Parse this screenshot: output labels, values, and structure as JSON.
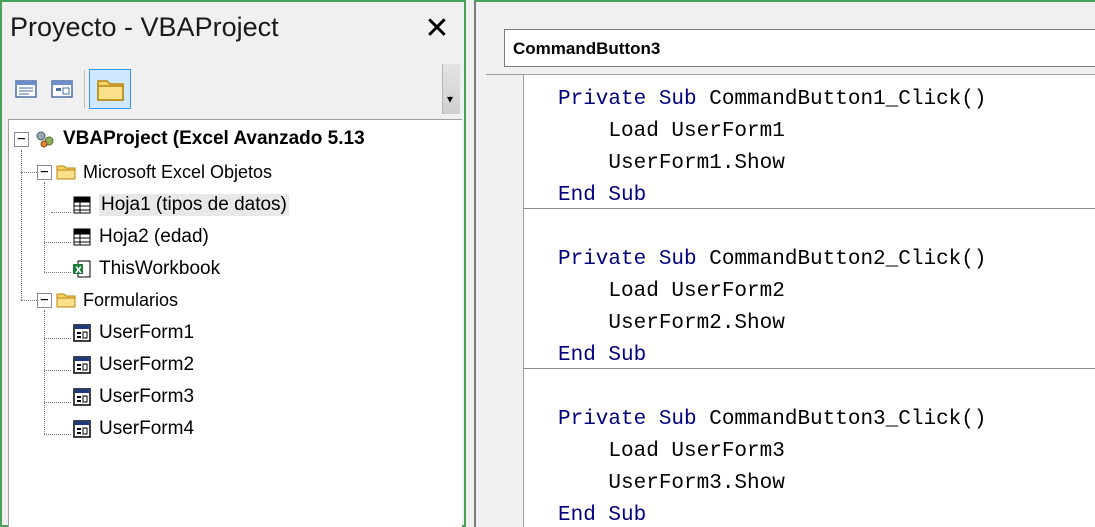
{
  "project_pane": {
    "title": "Proyecto - VBAProject",
    "close_label": "✕",
    "tree": {
      "root": "VBAProject (Excel Avanzado 5.13",
      "folders": [
        {
          "label": "Microsoft Excel Objetos",
          "items": [
            "Hoja1 (tipos de datos)",
            "Hoja2 (edad)",
            "ThisWorkbook"
          ]
        },
        {
          "label": "Formularios",
          "items": [
            "UserForm1",
            "UserForm2",
            "UserForm3",
            "UserForm4"
          ]
        }
      ],
      "selected_item": "Hoja1 (tipos de datos)"
    },
    "toolbar_icons": [
      "view-code-icon",
      "view-object-icon",
      "toggle-folders-icon"
    ]
  },
  "code_pane": {
    "object_selector": "CommandButton3",
    "procedures": [
      {
        "signature_kw": "Private Sub",
        "signature_name": " CommandButton1_Click()",
        "body": [
          "    Load UserForm1",
          "    UserForm1.Show"
        ],
        "end": "End Sub"
      },
      {
        "signature_kw": "Private Sub",
        "signature_name": " CommandButton2_Click()",
        "body": [
          "    Load UserForm2",
          "    UserForm2.Show"
        ],
        "end": "End Sub"
      },
      {
        "signature_kw": "Private Sub",
        "signature_name": " CommandButton3_Click()",
        "body": [
          "    Load UserForm3",
          "    UserForm3.Show"
        ],
        "end": "End Sub"
      }
    ]
  },
  "colors": {
    "keyword": "#00007f",
    "window_border": "#4aa35a",
    "selection_bg": "#e8e8e8"
  }
}
